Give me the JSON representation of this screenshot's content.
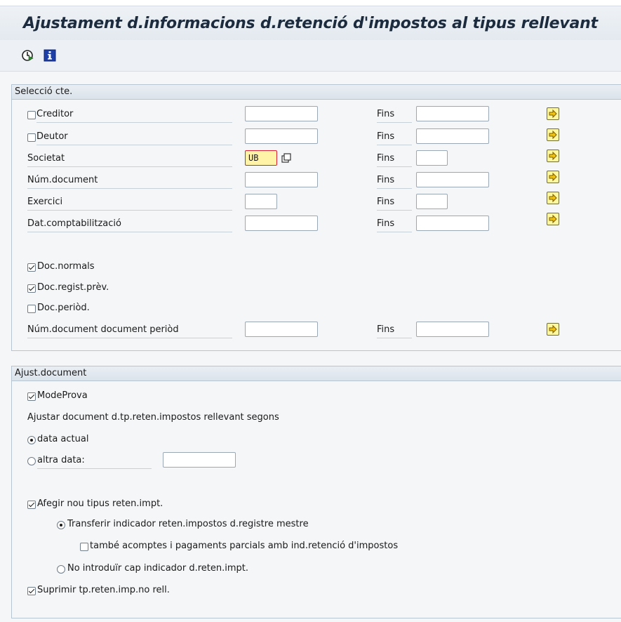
{
  "title": "Ajustament d.informacions d.retenció d'impostos al tipus rellevant",
  "toolbar": {
    "execute_icon": "execute-clock-icon",
    "info_icon": "information-icon"
  },
  "selection_group": {
    "header": "Selecció cte.",
    "to_label": "Fins",
    "rows": {
      "creditor": {
        "label": "Creditor",
        "checked": false,
        "from": "",
        "to": ""
      },
      "deutor": {
        "label": "Deutor",
        "checked": false,
        "from": "",
        "to": ""
      },
      "societat": {
        "label": "Societat",
        "from": "UB",
        "to": ""
      },
      "num_document": {
        "label": "Núm.document",
        "from": "",
        "to": ""
      },
      "exercici": {
        "label": "Exercici",
        "from": "",
        "to": ""
      },
      "data_comptab": {
        "label": "Dat.comptabilització",
        "from": "",
        "to": ""
      }
    },
    "options": {
      "doc_normals": {
        "label": "Doc.normals",
        "checked": true
      },
      "doc_regist_prev": {
        "label": "Doc.regist.prèv.",
        "checked": true
      },
      "doc_period": {
        "label": "Doc.periòd.",
        "checked": false
      }
    },
    "periodic_row": {
      "label": "Núm.document document periòd",
      "from": "",
      "to": ""
    }
  },
  "adjust_group": {
    "header": "Ajust.document",
    "mode_prova": {
      "label": "ModeProva",
      "checked": true
    },
    "instruction": "Ajustar document d.tp.reten.impostos rellevant segons",
    "radio_data_actual": {
      "label": "data actual",
      "selected": true
    },
    "radio_altra_data": {
      "label": "altra data:",
      "selected": false,
      "value": ""
    },
    "add_new": {
      "label": "Afegir nou tipus reten.impt.",
      "checked": true
    },
    "radio_transfer": {
      "label": "Transferir indicador reten.impostos d.registre mestre",
      "selected": true
    },
    "also_partial": {
      "label": "també acomptes i pagaments parcials amb ind.retenció d'impostos",
      "checked": false
    },
    "radio_no_indicator": {
      "label": "No introduïr cap indicador d.reten.impt.",
      "selected": false
    },
    "delete_non_rel": {
      "label": "Suprimir tp.reten.imp.no rell.",
      "checked": true
    }
  },
  "colors": {
    "accent_button": "#fff7a0",
    "active_field": "#fff3a8",
    "group_border": "#b7c5d3"
  }
}
